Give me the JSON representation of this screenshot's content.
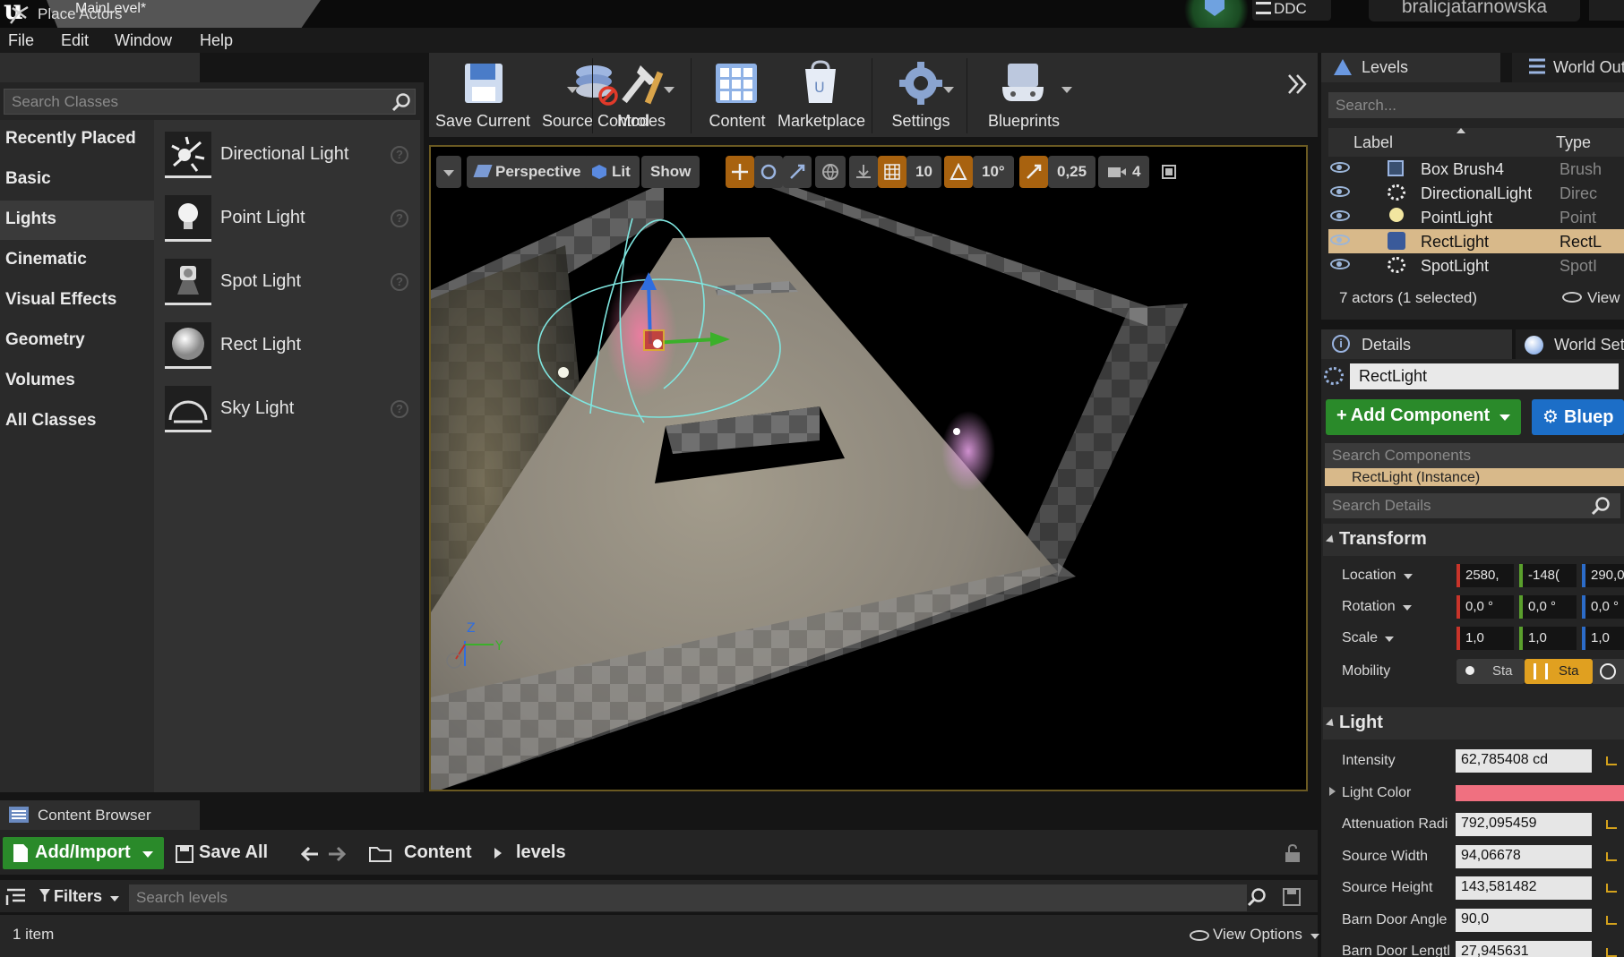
{
  "window": {
    "tab_title": "MainLevel*",
    "ddc_label": "DDC",
    "user": "bralicjatarnowska"
  },
  "menu": [
    "File",
    "Edit",
    "Window",
    "Help"
  ],
  "place_actors": {
    "tab_label": "Place Actors",
    "search_placeholder": "Search Classes",
    "categories": [
      "Recently Placed",
      "Basic",
      "Lights",
      "Cinematic",
      "Visual Effects",
      "Geometry",
      "Volumes",
      "All Classes"
    ],
    "selected_category": "Lights",
    "items": [
      "Directional Light",
      "Point Light",
      "Spot Light",
      "Rect Light",
      "Sky Light"
    ]
  },
  "toolbar": {
    "buttons": [
      "Save Current",
      "Source Control",
      "Modes",
      "Content",
      "Marketplace",
      "Settings",
      "Blueprints"
    ]
  },
  "viewport": {
    "view_mode": "Perspective",
    "lighting_mode": "Lit",
    "show_label": "Show",
    "grid_snap": "10",
    "rotation_snap": "10°",
    "scale_snap": "0,25",
    "camera_speed": "4",
    "axis_labels": [
      "Z",
      "Y"
    ]
  },
  "levels": {
    "tab_label": "Levels",
    "world_outliner_tab": "World Out",
    "search_placeholder": "Search...",
    "columns": [
      "Label",
      "Type"
    ],
    "rows": [
      {
        "label": "Box Brush4",
        "type": "Brush"
      },
      {
        "label": "DirectionalLight",
        "type": "Direc"
      },
      {
        "label": "PointLight",
        "type": "Point"
      },
      {
        "label": "RectLight",
        "type": "RectL"
      },
      {
        "label": "SpotLight",
        "type": "SpotI"
      }
    ],
    "selected_row": "RectLight",
    "actors_count": "7 actors (1 selected)",
    "view_label": "View"
  },
  "details": {
    "tab_label": "Details",
    "world_settings_tab": "World Set",
    "actor_name": "RectLight",
    "add_component": "Add Component",
    "blueprint_button": "Bluep",
    "search_components_placeholder": "Search Components",
    "component_row": "RectLight (Instance)",
    "search_details_placeholder": "Search Details",
    "transform": {
      "title": "Transform",
      "location_label": "Location",
      "rotation_label": "Rotation",
      "scale_label": "Scale",
      "mobility_label": "Mobility",
      "location": [
        "2580,",
        "-148(",
        "290,0"
      ],
      "rotation": [
        "0,0 °",
        "0,0 °",
        "0,0 °"
      ],
      "scale": [
        "1,0",
        "1,0",
        "1,0"
      ],
      "mobility_options": [
        "Sta",
        "Sta"
      ]
    },
    "light": {
      "title": "Light",
      "light_color": "#f07080",
      "props": [
        {
          "label": "Intensity",
          "value": "62,785408 cd"
        },
        {
          "label": "Light Color",
          "value": ""
        },
        {
          "label": "Attenuation Radi",
          "value": "792,095459"
        },
        {
          "label": "Source Width",
          "value": "94,06678"
        },
        {
          "label": "Source Height",
          "value": "143,581482"
        },
        {
          "label": "Barn Door Angle",
          "value": "90,0"
        },
        {
          "label": "Barn Door Lengtl",
          "value": "27,945631"
        }
      ]
    }
  },
  "content_browser": {
    "tab_label": "Content Browser",
    "add_import": "Add/Import",
    "save_all": "Save All",
    "breadcrumb": [
      "Content",
      "levels"
    ],
    "filters": "Filters",
    "search_placeholder": "Search levels",
    "items_count": "1 item",
    "view_options": "View Options"
  }
}
